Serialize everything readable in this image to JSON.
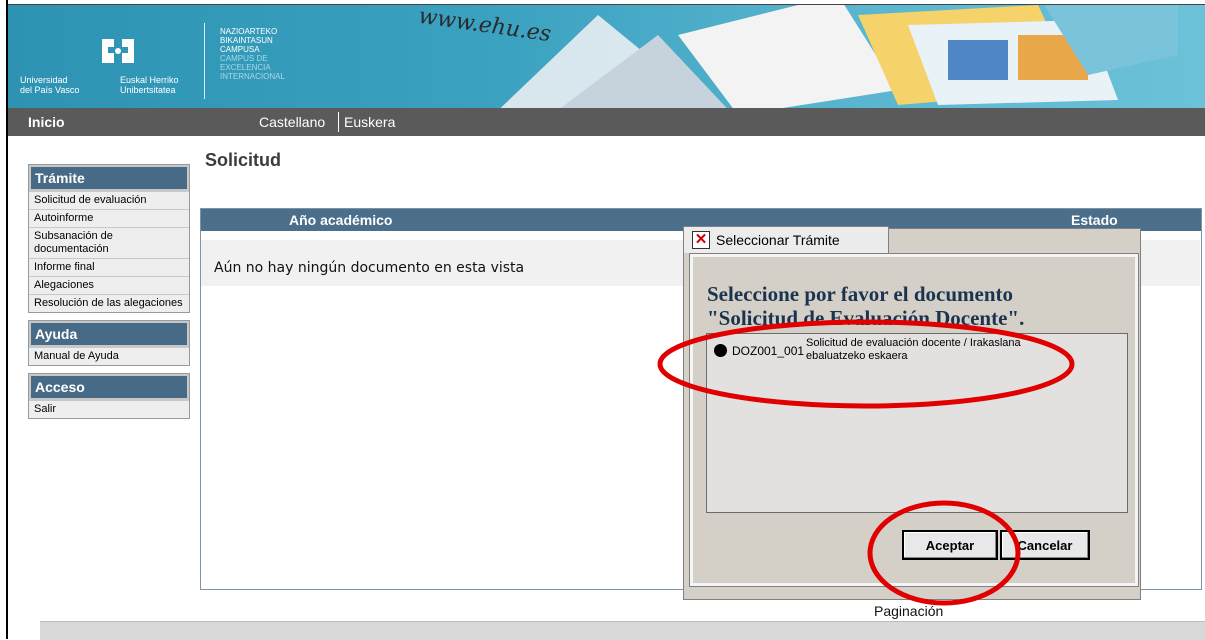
{
  "header": {
    "logo_university_es": "Universidad\ndel País Vasco",
    "logo_university_eu": "Euskal Herriko\nUnibertsitatea",
    "campus_lines": [
      "NAZIOARTEKO",
      "BIKAINTASUN",
      "CAMPUSA"
    ],
    "campus_lines_dim": [
      "CAMPUS DE",
      "EXCELENCIA",
      "INTERNACIONAL"
    ],
    "website": "www.ehu.es"
  },
  "navbar": {
    "home": "Inicio",
    "lang_es": "Castellano",
    "lang_eu": "Euskera"
  },
  "sidebar": {
    "sections": [
      {
        "title": "Trámite",
        "items": [
          "Solicitud de evaluación",
          "Autoinforme",
          "Subsanación de documentación",
          "Informe final",
          "Alegaciones",
          "Resolución de las alegaciones"
        ]
      },
      {
        "title": "Ayuda",
        "items": [
          "Manual de Ayuda"
        ]
      },
      {
        "title": "Acceso",
        "items": [
          "Salir"
        ]
      }
    ]
  },
  "main": {
    "title": "Solicitud",
    "columns": [
      "Año académico",
      "Estado"
    ],
    "empty_message": "Aún no hay ningún documento en esta vista",
    "pagination": "Paginación"
  },
  "dialog": {
    "title": "Seleccionar Trámite",
    "heading_line1": "Seleccione por favor el documento",
    "heading_line2": "\"Solicitud de Evaluación Docente\".",
    "option": {
      "code": "DOZ001_001",
      "label": "Solicitud de evaluación docente / Irakaslana ebaluatzeko eskaera",
      "selected": true
    },
    "ok_label": "Aceptar",
    "cancel_label": "Cancelar"
  },
  "colors": {
    "header_blue": "#3aa1c0",
    "navbar": "#5a5a5a",
    "section_head": "#476b87",
    "annotation_red": "#e00000"
  }
}
